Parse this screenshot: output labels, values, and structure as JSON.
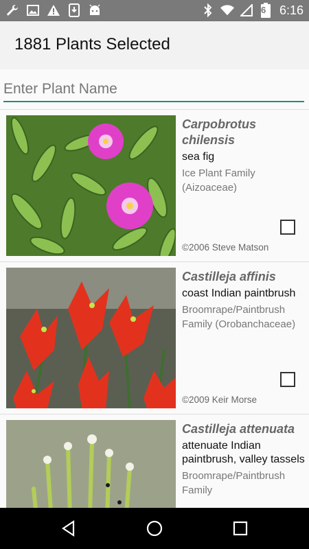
{
  "status_bar": {
    "time": "6:16",
    "battery_level": "6",
    "left_icons": [
      "wrench-icon",
      "image-icon",
      "warning-icon",
      "download-icon",
      "android-icon"
    ],
    "right_icons": [
      "bluetooth-icon",
      "wifi-icon",
      "signal-icon",
      "battery-icon"
    ]
  },
  "app_bar": {
    "title": "1881 Plants Selected"
  },
  "search": {
    "placeholder": "Enter Plant Name",
    "value": ""
  },
  "plants": [
    {
      "scientific_name": "Carpobrotus chilensis",
      "common_name": "sea fig",
      "family": "Ice Plant Family (Aizoaceae)",
      "credit": "©2006 Steve Matson",
      "selected": false
    },
    {
      "scientific_name": "Castilleja affinis",
      "common_name": "coast Indian paintbrush",
      "family": "Broomrape/Paintbrush Family (Orobanchaceae)",
      "credit": "©2009 Keir Morse",
      "selected": false
    },
    {
      "scientific_name": "Castilleja attenuata",
      "common_name": "attenuate Indian paintbrush, valley tassels",
      "family": "Broomrape/Paintbrush Family",
      "credit": "",
      "selected": false
    }
  ],
  "nav": {
    "back": "back-icon",
    "home": "home-icon",
    "recents": "recents-icon"
  },
  "colors": {
    "accent": "#1a8c80",
    "status_bar": "#7a7a7a",
    "nav_bar": "#000000"
  }
}
